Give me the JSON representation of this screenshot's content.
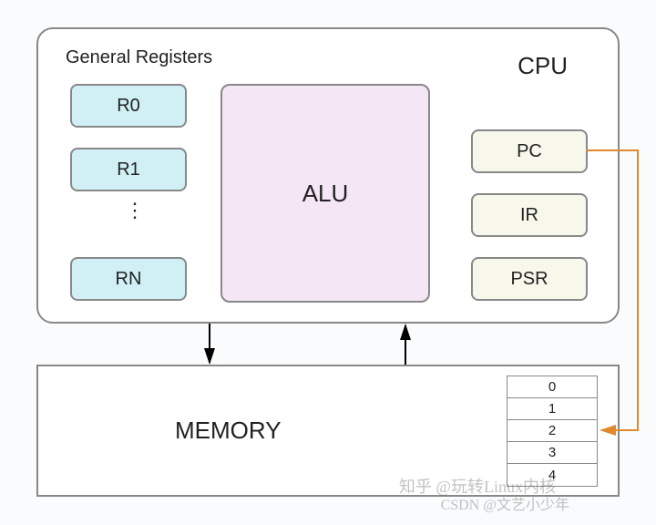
{
  "cpu": {
    "title": "CPU",
    "general_registers_label": "General Registers",
    "registers": {
      "r0": "R0",
      "r1": "R1",
      "rn": "RN",
      "ellipsis": "⋮"
    },
    "alu_label": "ALU",
    "special_registers": {
      "pc": "PC",
      "ir": "IR",
      "psr": "PSR"
    }
  },
  "memory": {
    "title": "MEMORY",
    "cells": [
      "0",
      "1",
      "2",
      "3",
      "4"
    ]
  },
  "watermarks": {
    "w1": "知乎 @玩转Linux内核",
    "w2": "CSDN @文艺小少年"
  },
  "arrows": {
    "cpu_to_memory": {
      "from": "CPU bottom (left of ALU)",
      "to": "MEMORY top"
    },
    "memory_to_cpu": {
      "from": "MEMORY top",
      "to": "CPU bottom (right of ALU)"
    },
    "pc_to_memcell": {
      "from": "PC register",
      "to": "memory cell 2",
      "color": "orange"
    }
  }
}
